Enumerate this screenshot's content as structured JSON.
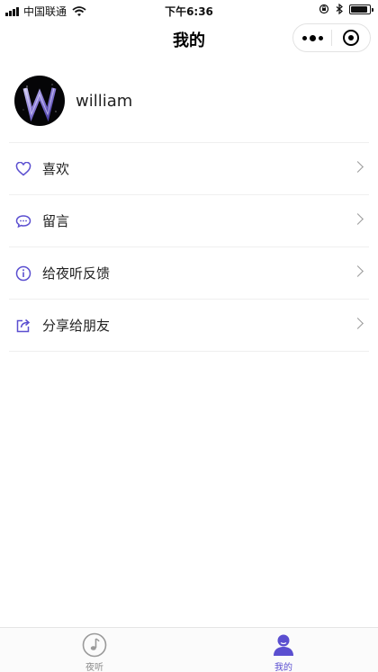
{
  "status_bar": {
    "carrier": "中国联通",
    "time": "下午6:36",
    "battery_level": 0.9
  },
  "nav": {
    "title": "我的"
  },
  "profile": {
    "username": "william"
  },
  "menu": {
    "items": [
      {
        "label": "喜欢",
        "icon": "heart-icon"
      },
      {
        "label": "留言",
        "icon": "comment-icon"
      },
      {
        "label": "给夜听反馈",
        "icon": "info-icon"
      },
      {
        "label": "分享给朋友",
        "icon": "share-icon"
      }
    ]
  },
  "tabs": [
    {
      "label": "夜听",
      "icon": "music-note-icon",
      "active": false
    },
    {
      "label": "我的",
      "icon": "user-icon",
      "active": true
    }
  ],
  "colors": {
    "accent": "#5b4fd0",
    "inactive": "#8a8a8a"
  }
}
